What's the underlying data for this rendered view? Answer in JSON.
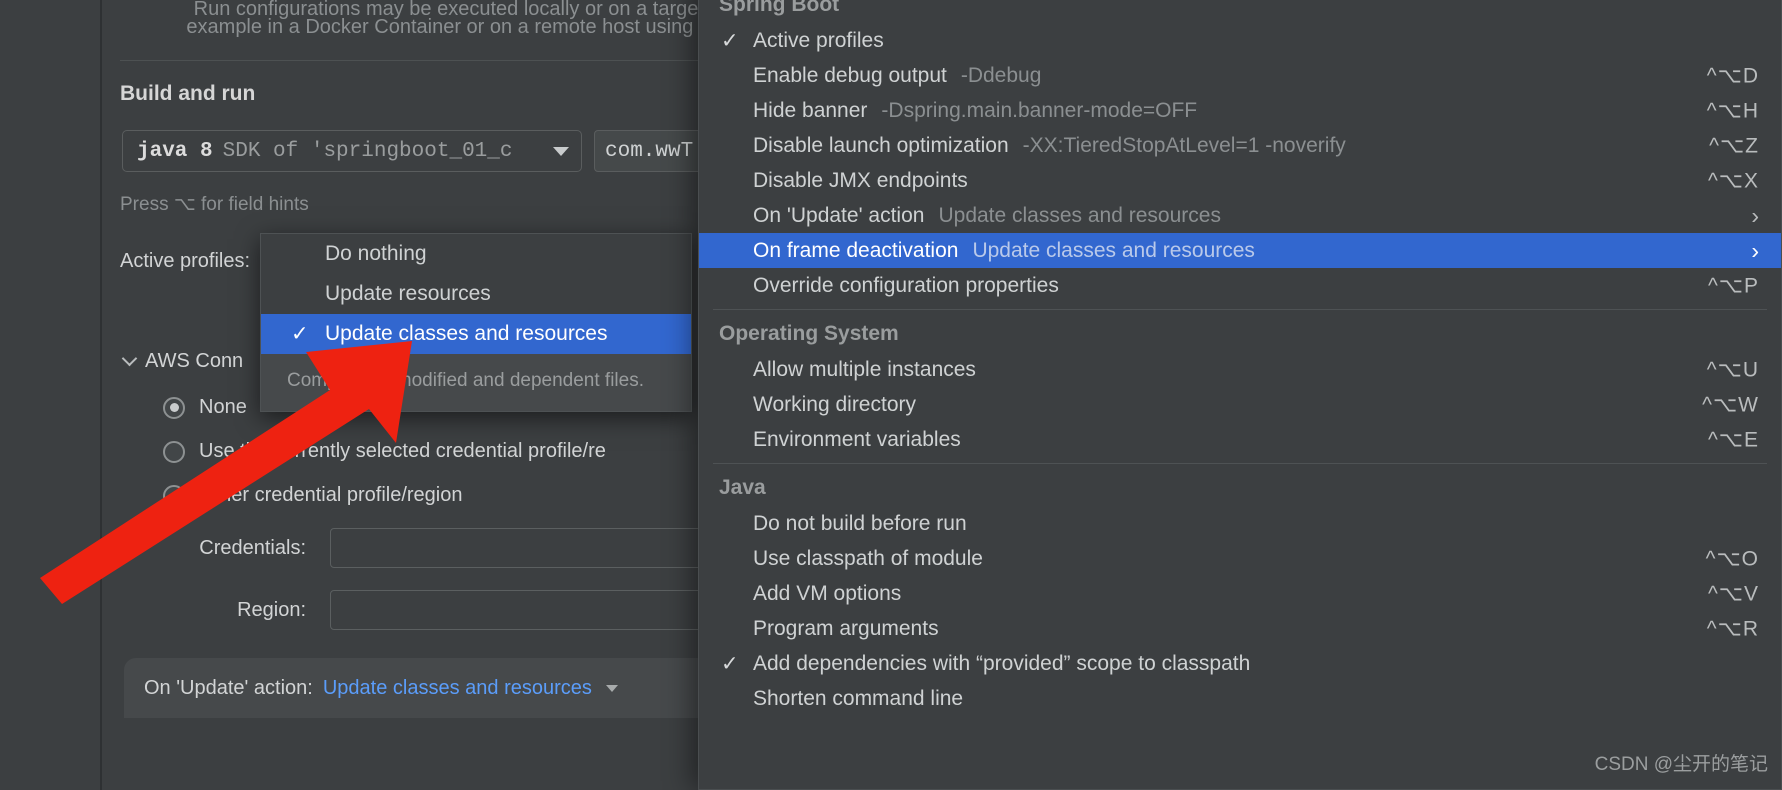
{
  "dialog": {
    "intro_line1": "Run configurations may be executed locally or on a target: for",
    "intro_line2": "example in a Docker Container or on a remote host using SSH.",
    "section_title": "Build and run",
    "sdk_combo": {
      "main": "java 8",
      "sub": "SDK of 'springboot_01_c",
      "caret": "chevron-down-icon"
    },
    "main_class_value": "com.wwT",
    "field_hint": "Press ⌥ for field hints",
    "active_profiles_label": "Active profiles:",
    "aws_group": {
      "title": "AWS Conn",
      "options": [
        {
          "label": "None",
          "selected": true
        },
        {
          "label": "Use the currently selected credential profile/re",
          "selected": false
        },
        {
          "label": "Other credential profile/region",
          "selected": false
        }
      ],
      "fields": [
        {
          "label": "Credentials:",
          "value": ""
        },
        {
          "label": "Region:",
          "value": ""
        }
      ]
    },
    "bottom_bar": {
      "prefix": "On 'Update' action:",
      "link": "Update classes and resources",
      "caret": "chevron-down-icon"
    }
  },
  "update_action_popup": {
    "items": [
      {
        "label": "Do nothing",
        "checked": false,
        "selected": false
      },
      {
        "label": "Update resources",
        "checked": false,
        "selected": false
      },
      {
        "label": "Update classes and resources",
        "checked": true,
        "selected": true
      }
    ],
    "description": "Compiles all modified and dependent files."
  },
  "context_menu": {
    "groups": [
      {
        "title": "Spring Boot",
        "items": [
          {
            "label": "Active profiles",
            "value": "",
            "accel": "",
            "checked": true,
            "submenu": false,
            "selected": false
          },
          {
            "label": "Enable debug output",
            "value": "-Ddebug",
            "accel": "^⌥D",
            "checked": false,
            "submenu": false,
            "selected": false
          },
          {
            "label": "Hide banner",
            "value": "-Dspring.main.banner-mode=OFF",
            "accel": "^⌥H",
            "checked": false,
            "submenu": false,
            "selected": false
          },
          {
            "label": "Disable launch optimization",
            "value": "-XX:TieredStopAtLevel=1 -noverify",
            "accel": "^⌥Z",
            "checked": false,
            "submenu": false,
            "selected": false
          },
          {
            "label": "Disable JMX endpoints",
            "value": "",
            "accel": "^⌥X",
            "checked": false,
            "submenu": false,
            "selected": false
          },
          {
            "label": "On 'Update' action",
            "value": "Update classes and resources",
            "accel": "",
            "checked": false,
            "submenu": true,
            "selected": false
          },
          {
            "label": "On frame deactivation",
            "value": "Update classes and resources",
            "accel": "",
            "checked": false,
            "submenu": true,
            "selected": true
          },
          {
            "label": "Override configuration properties",
            "value": "",
            "accel": "^⌥P",
            "checked": false,
            "submenu": false,
            "selected": false
          }
        ]
      },
      {
        "title": "Operating System",
        "items": [
          {
            "label": "Allow multiple instances",
            "value": "",
            "accel": "^⌥U",
            "checked": false,
            "submenu": false,
            "selected": false
          },
          {
            "label": "Working directory",
            "value": "",
            "accel": "^⌥W",
            "checked": false,
            "submenu": false,
            "selected": false
          },
          {
            "label": "Environment variables",
            "value": "",
            "accel": "^⌥E",
            "checked": false,
            "submenu": false,
            "selected": false
          }
        ]
      },
      {
        "title": "Java",
        "items": [
          {
            "label": "Do not build before run",
            "value": "",
            "accel": "",
            "checked": false,
            "submenu": false,
            "selected": false
          },
          {
            "label": "Use classpath of module",
            "value": "",
            "accel": "^⌥O",
            "checked": false,
            "submenu": false,
            "selected": false
          },
          {
            "label": "Add VM options",
            "value": "",
            "accel": "^⌥V",
            "checked": false,
            "submenu": false,
            "selected": false
          },
          {
            "label": "Program arguments",
            "value": "",
            "accel": "^⌥R",
            "checked": false,
            "submenu": false,
            "selected": false
          },
          {
            "label": "Add dependencies with “provided” scope to classpath",
            "value": "",
            "accel": "",
            "checked": true,
            "submenu": false,
            "selected": false
          },
          {
            "label": "Shorten command line",
            "value": "",
            "accel": "",
            "checked": false,
            "submenu": false,
            "selected": false
          }
        ]
      }
    ]
  },
  "annotation": {
    "type": "red-arrow",
    "color": "#ee2211"
  },
  "watermark": "CSDN @尘开的笔记",
  "colors": {
    "background": "#3c3f41",
    "selection": "#3267cf",
    "text": "#cfd2d3",
    "muted": "#8b8f91",
    "link": "#5b9dfa",
    "accent_red": "#ee2211"
  }
}
